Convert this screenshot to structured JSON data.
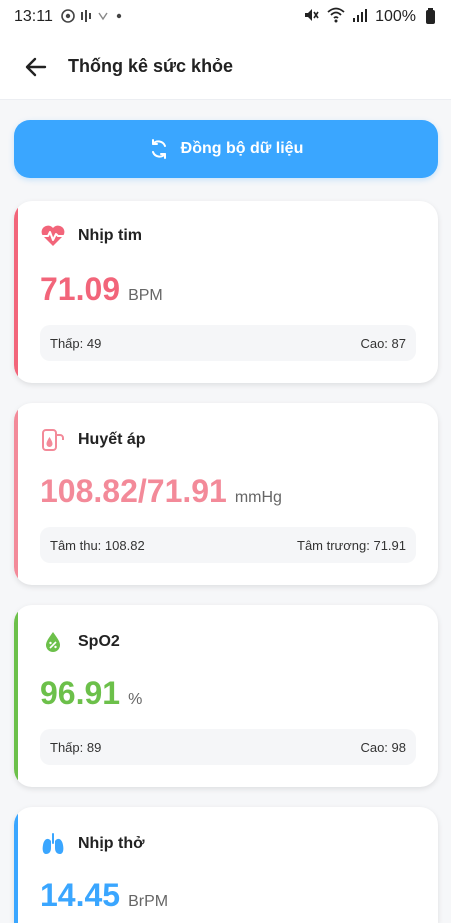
{
  "status_bar": {
    "time": "13:11",
    "battery": "100%"
  },
  "app_bar": {
    "title": "Thống kê sức khỏe",
    "back_icon": "arrow-left-icon"
  },
  "sync": {
    "label": "Đồng bộ dữ liệu",
    "icon": "sync-icon"
  },
  "cards": [
    {
      "title": "Nhịp tim",
      "icon": "heart-pulse-icon",
      "value": "71.09",
      "unit": "BPM",
      "color": "#f2657a",
      "left_label": "Thấp: 49",
      "right_label": "Cao: 87"
    },
    {
      "title": "Huyết áp",
      "icon": "blood-pressure-icon",
      "value": "108.82/71.91",
      "unit": "mmHg",
      "color": "#f38a99",
      "left_label": "Tâm thu: 108.82",
      "right_label": "Tâm trương: 71.91"
    },
    {
      "title": "SpO2",
      "icon": "oxygen-drop-icon",
      "value": "96.91",
      "unit": "%",
      "color": "#6cc04a",
      "left_label": "Thấp: 89",
      "right_label": "Cao: 98"
    },
    {
      "title": "Nhịp thở",
      "icon": "lungs-icon",
      "value": "14.45",
      "unit": "BrPM",
      "color": "#3aa6ff"
    }
  ]
}
